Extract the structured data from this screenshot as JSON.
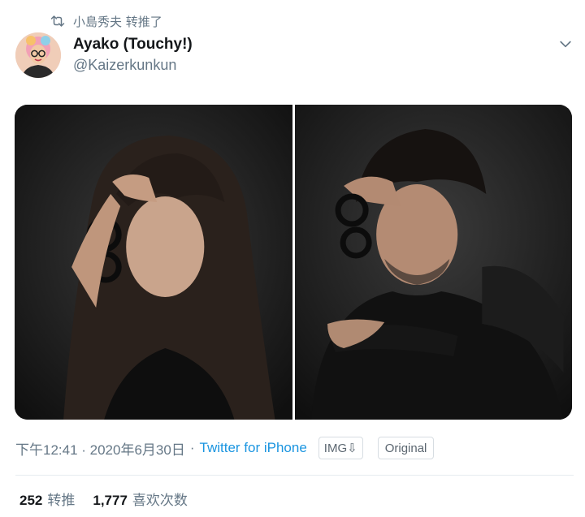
{
  "retweet": {
    "text": "小島秀夫 转推了",
    "icon": "retweet-icon"
  },
  "author": {
    "display_name": "Ayako (Touchy!)",
    "handle": "@Kaizerkunkun",
    "avatar_icon": "avatar-photo"
  },
  "media": {
    "photos": [
      {
        "subject": "woman with long dark hair holding glasses to forehead"
      },
      {
        "subject": "man with dark hair holding glasses to forehead"
      }
    ]
  },
  "meta": {
    "timestamp": "下午12:41 · 2020年6月30日",
    "separator": "·",
    "source": "Twitter for iPhone",
    "img_chip": "IMG⇩",
    "original_chip": "Original"
  },
  "stats": {
    "retweets": {
      "count": "252",
      "label": "转推"
    },
    "likes": {
      "count": "1,777",
      "label": "喜欢次数"
    }
  },
  "colors": {
    "link": "#1b95e0",
    "secondary_text": "#657786",
    "primary_text": "#14171a",
    "divider": "#e6ecf0"
  }
}
